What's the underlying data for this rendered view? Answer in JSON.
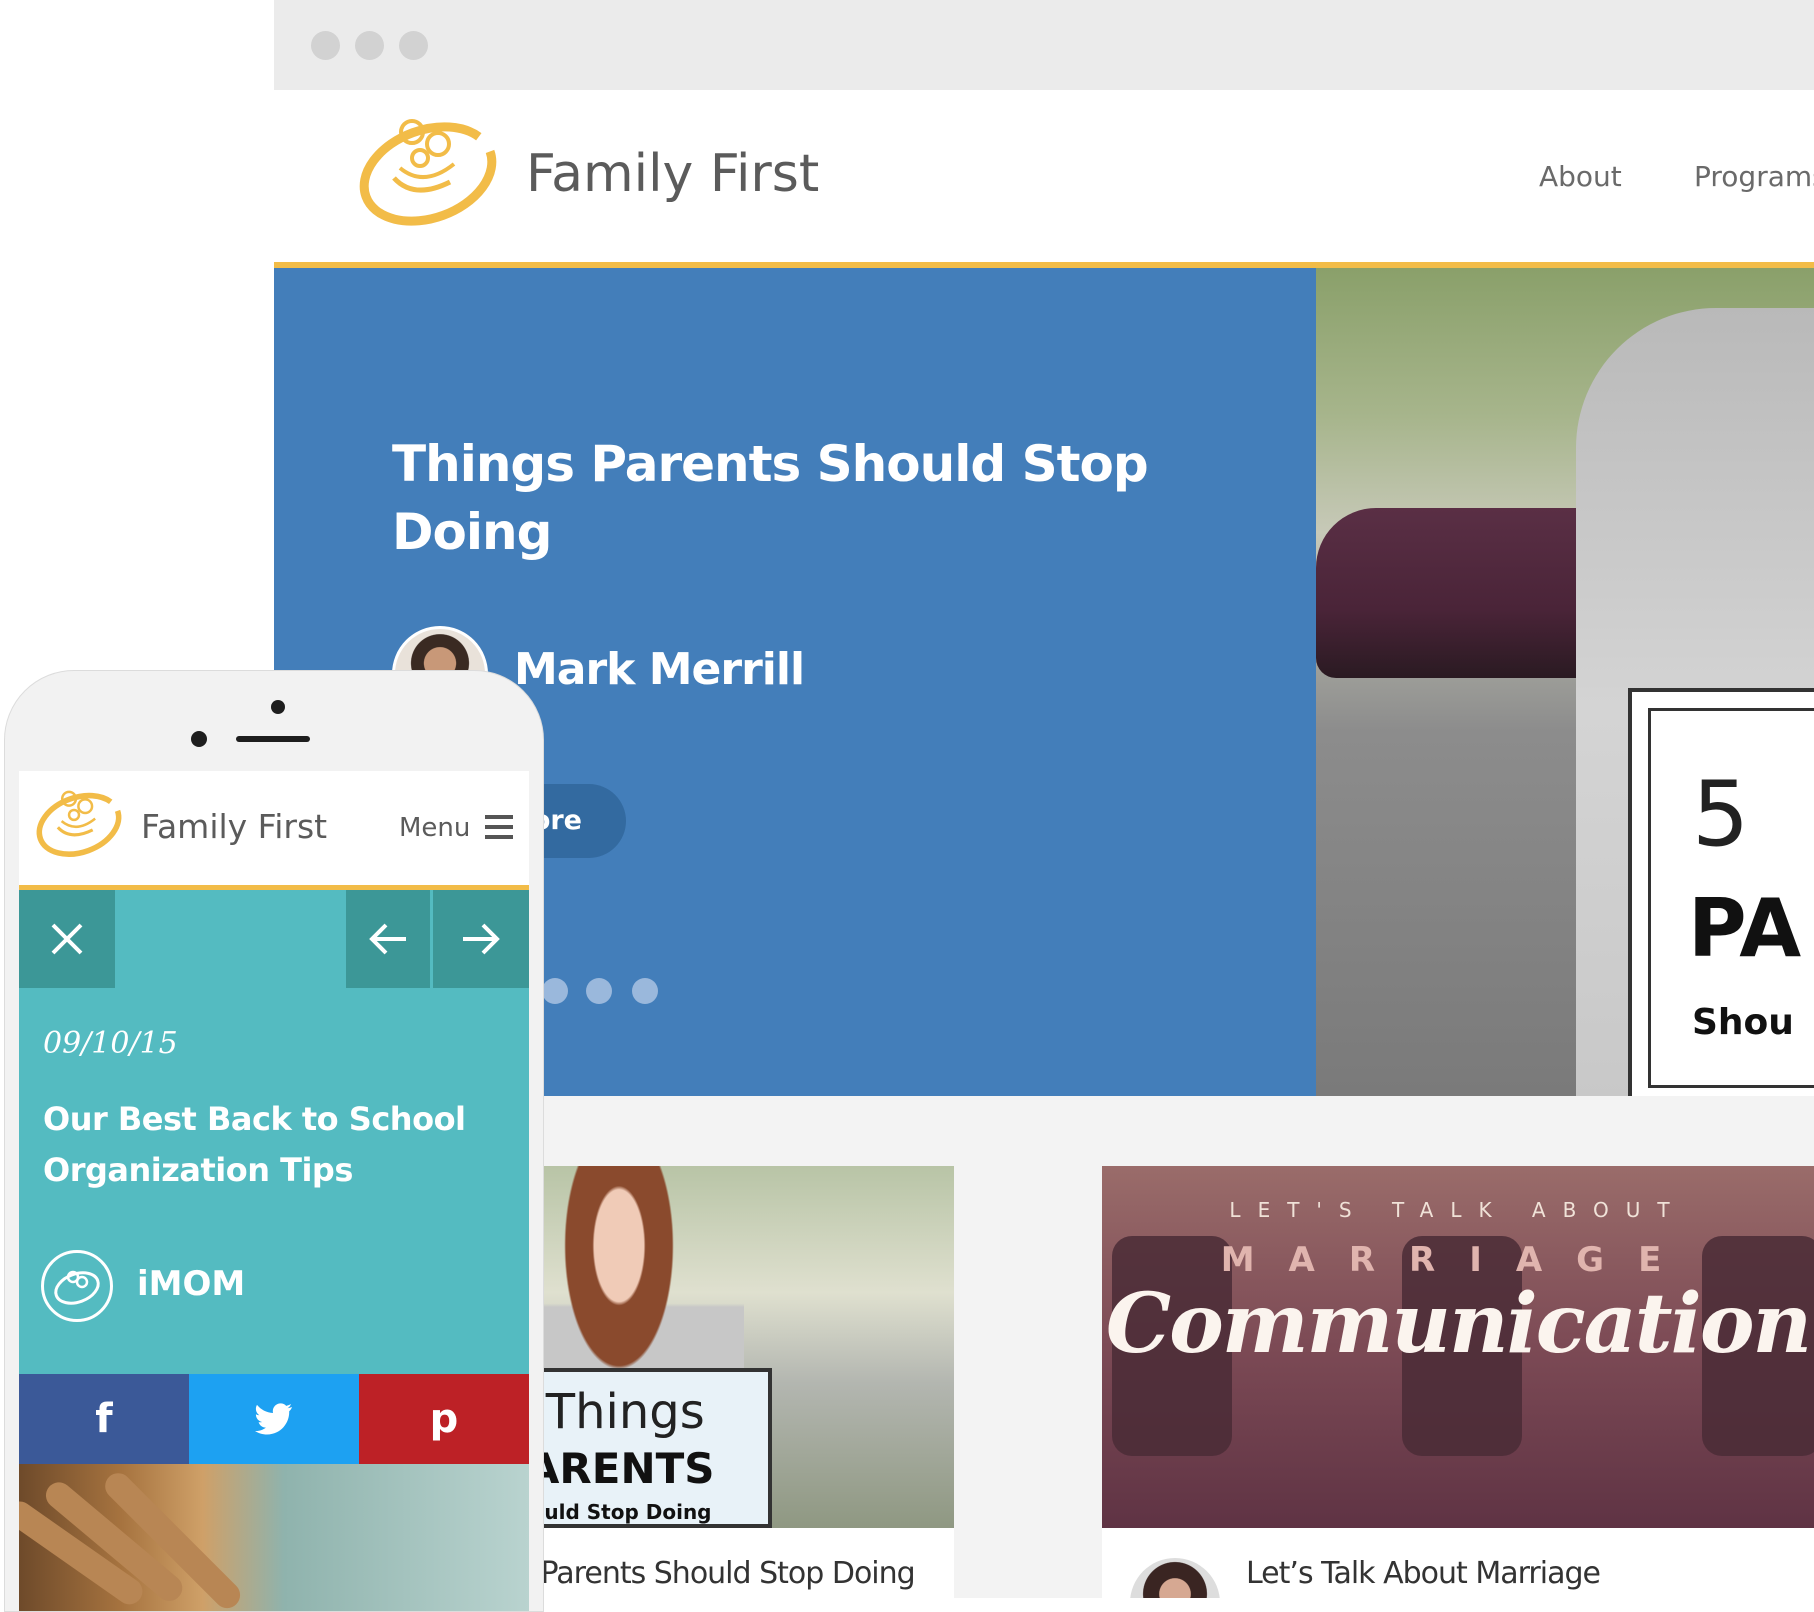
{
  "brand": {
    "name": "Family First",
    "colors": {
      "accent": "#f2bc48",
      "hero_blue": "#437eba",
      "text_gray": "#5b5b5b"
    }
  },
  "desktop": {
    "nav": [
      {
        "label": "About"
      },
      {
        "label": "Programs"
      }
    ],
    "hero": {
      "title": "Things Parents Should Stop Doing",
      "author": "Mark Merrill",
      "button_label": "ore",
      "slide_count_visible": 3,
      "photo_sign": {
        "line1": "5",
        "line2": "PA",
        "line3": "Shou"
      }
    },
    "cards": [
      {
        "image_sign": {
          "line1": "5 Things",
          "line2": "PARENTS",
          "line3": "Should Stop Doing"
        },
        "title": "ings Parents Should Stop Doing"
      },
      {
        "image_text": {
          "line1": "LET'S TALK ABOUT",
          "line2": "MARRIAGE",
          "line3": "Communication"
        },
        "title": "Let’s Talk About Marriage"
      }
    ]
  },
  "mobile": {
    "brand": "Family First",
    "menu_label": "Menu",
    "icons": {
      "close": "close-icon",
      "prev": "arrow-left-icon",
      "next": "arrow-right-icon",
      "menu": "hamburger-icon"
    },
    "post": {
      "date": "09/10/15",
      "title": "Our Best Back to School Organization Tips",
      "source": "iMOM",
      "panel_color": "#54bbc1"
    },
    "share": [
      {
        "network": "facebook",
        "glyph": "f",
        "color": "#3b5998"
      },
      {
        "network": "twitter",
        "glyph": "t",
        "color": "#1da1f2"
      },
      {
        "network": "pinterest",
        "glyph": "p",
        "color": "#bd2126"
      }
    ]
  }
}
